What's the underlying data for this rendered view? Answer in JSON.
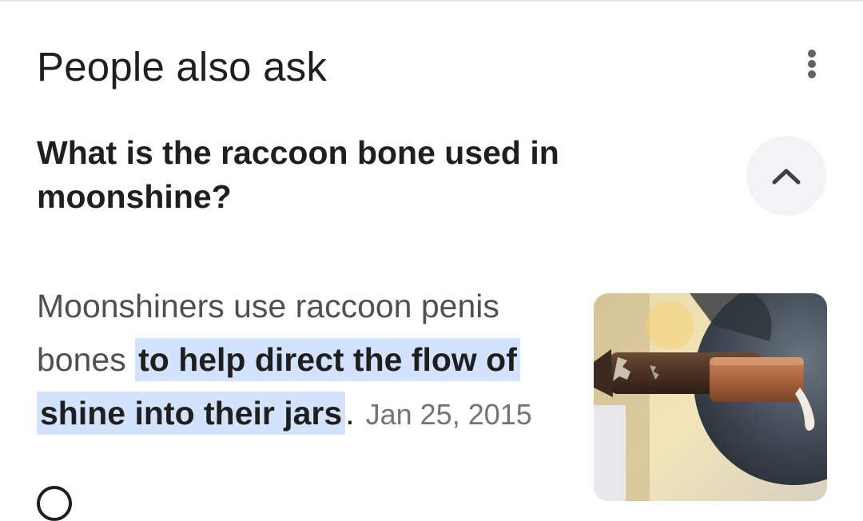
{
  "section": {
    "title": "People also ask"
  },
  "question": {
    "text": "What is the raccoon bone used in moonshine?"
  },
  "answer": {
    "lead": "Moonshiners use raccoon penis bones ",
    "highlight": "to help direct the flow of shine into their jars",
    "tail": ".",
    "date": "Jan 25, 2015"
  },
  "icons": {
    "more": "more-vert-icon",
    "collapse": "chevron-up-icon"
  },
  "colors": {
    "highlight": "#d3e3fd",
    "button_bg": "#f1f3f4",
    "text_primary": "#1f1f1f",
    "text_secondary": "#4d5156",
    "date": "#70757a"
  }
}
